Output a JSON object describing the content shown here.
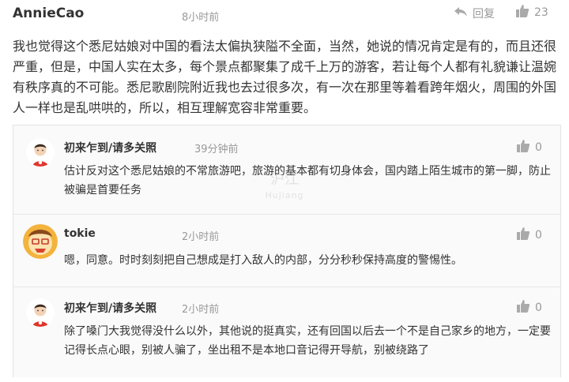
{
  "post": {
    "author": "AnnieCao",
    "time": "8小时前",
    "reply_label": "回复",
    "likes": "23",
    "text": "我也觉得这个悉尼姑娘对中国的看法太偏执狭隘不全面，当然，她说的情况肯定是有的，而且还很严重，但是，中国人实在太多，每个景点都聚集了成千上万的游客，若让每个人都有礼貌谦让温婉有秩序真的不可能。悉尼歌剧院附近我也去过很多次，有一次在那里等着看跨年烟火，周围的外国人一样也是乱哄哄的，所以，相互理解宽容非常重要。"
  },
  "comments": [
    {
      "author": "初来乍到/请多关照",
      "time": "39分钟前",
      "likes": "0",
      "text": "估计反对这个悉尼姑娘的不常旅游吧，旅游的基本都有切身体会，国内踏上陌生城市的第一脚，防止被骗是首要任务",
      "avatar": "man-avatar-icon"
    },
    {
      "author": "tokie",
      "time": "2小时前",
      "likes": "0",
      "text": "嗯，同意。时时刻刻把自己想成是打入敌人的内部，分分秒秒保持高度的警惕性。",
      "avatar": "cartoon-avatar-icon"
    },
    {
      "author": "初来乍到/请多关照",
      "time": "2小时前",
      "likes": "0",
      "text": "除了嗓门大我觉得没什么以外，其他说的挺真实，还有回国以后去一个不是自己家乡的地方，一定要记得长点心眼，别被人骗了，坐出租不是本地口音记得开导航，别被绕路了",
      "avatar": "man-avatar-icon"
    }
  ],
  "watermark": {
    "line1": "沪江",
    "line2": "Hujiang"
  },
  "colors": {
    "meta": "#999999",
    "text": "#333333",
    "sub_bg": "#fafafa",
    "border": "#e3e3e3"
  }
}
